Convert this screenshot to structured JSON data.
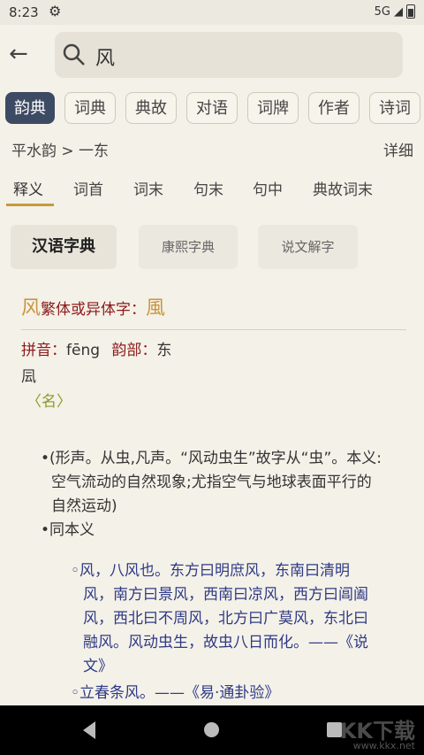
{
  "status": {
    "time": "8:23",
    "network": "5G"
  },
  "search": {
    "query": "风"
  },
  "tabs": [
    "韵典",
    "词典",
    "典故",
    "对语",
    "词牌",
    "作者",
    "诗词"
  ],
  "breadcrumb": "平水韵 > 一东",
  "detail_label": "详细",
  "subtabs": [
    "释义",
    "词首",
    "词末",
    "句末",
    "句中",
    "典故词末"
  ],
  "dicts": [
    "汉语字典",
    "康熙字典",
    "说文解字"
  ],
  "entry": {
    "char": "风",
    "trad_label": "繁体或异体字：",
    "trad_char": "風",
    "pinyin_label": "拼音：",
    "pinyin": "fēng",
    "radical_label": "韵部：",
    "radical": "东",
    "repeat": "凨",
    "pos": "〈名〉",
    "defs": [
      "•(形声。从虫,凡声。“风动虫生”故字从“虫”。本义:",
      "空气流动的自然现象;尤指空气与地球表面平行的",
      "自然运动)",
      "•同本义"
    ],
    "subdefs": [
      "◦风，八风也。东方曰明庶风，东南曰清明",
      "风，南方曰景风，西南曰凉风，西方曰阊阖",
      "风，西北曰不周风，北方曰广莫风，东北曰",
      "融风。风动虫生，故虫八日而化。——《说",
      "文》",
      "◦立春条风。——《易·通卦验》"
    ]
  },
  "watermark": {
    "main": "KK下载",
    "sub": "www.kkx.net"
  }
}
